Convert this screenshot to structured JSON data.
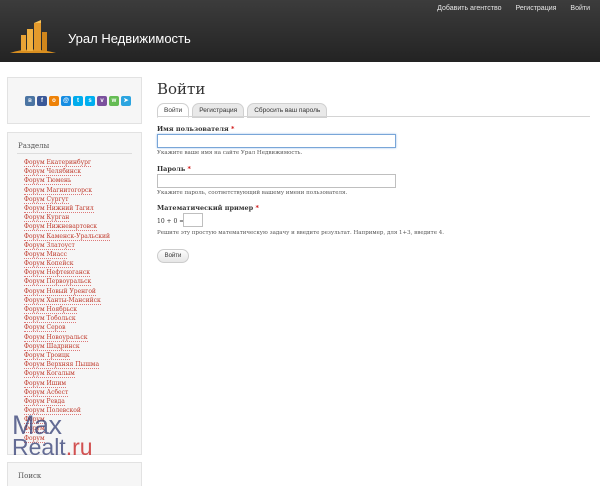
{
  "header": {
    "site_name": "Урал Недвижимость",
    "links": [
      "Добавить агентство",
      "Регистрация",
      "Войти"
    ]
  },
  "share": {
    "icons": [
      "vk-icon",
      "facebook-icon",
      "odnoklassniki-icon",
      "moimir-icon",
      "twitter-icon",
      "skype-icon",
      "viber-icon",
      "whatsapp-icon",
      "telegram-icon"
    ],
    "colors": [
      "#4c75a3",
      "#3b5998",
      "#ee8208",
      "#168de2",
      "#00aced",
      "#00aff0",
      "#7b519d",
      "#65bc54",
      "#2ca5e0"
    ]
  },
  "sidebar": {
    "razdely_title": "Разделы",
    "forums": [
      "Форум Екатеринбург",
      "Форум Челябинск",
      "Форум Тюмень",
      "Форум Магнитогорск",
      "Форум Сургут",
      "Форум Нижний Тагил",
      "Форум Курган",
      "Форум Нижневартовск",
      "Форум Каменск-Уральский",
      "Форум Златоуст",
      "Форум Миасс",
      "Форум Копейск",
      "Форум Нефтеюганск",
      "Форум Первоуральск",
      "Форум Новый Уренгой",
      "Форум Ханты-Мансийск",
      "Форум Ноябрьск",
      "Форум Тобольск",
      "Форум Серов",
      "Форум Новоуральск",
      "Форум Шадринск",
      "Форум Троицк",
      "Форум Верхняя Пышма",
      "Форум Когалым",
      "Форум Ишим",
      "Форум Асбест",
      "Форум Ревда",
      "Форум Полевской",
      "Форум",
      "Форум",
      "Форум"
    ],
    "poisk_title": "Поиск"
  },
  "watermark": {
    "max": "Max",
    "realt": "Realt",
    "ru": ".ru"
  },
  "main": {
    "title": "Войти",
    "tabs": [
      "Войти",
      "Регистрация",
      "Сбросить ваш пароль"
    ],
    "username_label": "Имя пользователя",
    "username_desc": "Укажите ваше имя на сайте Урал Недвижимость.",
    "password_label": "Пароль",
    "password_desc": "Укажите пароль, соответствующий вашему имени пользователя.",
    "captcha_label": "Математический пример",
    "captcha_question": "10 + 0 =",
    "captcha_desc": "Решите эту простую математическую задачу и введите результат. Например, для 1+3, введите 4.",
    "required_mark": "*",
    "submit_label": "Войти"
  }
}
